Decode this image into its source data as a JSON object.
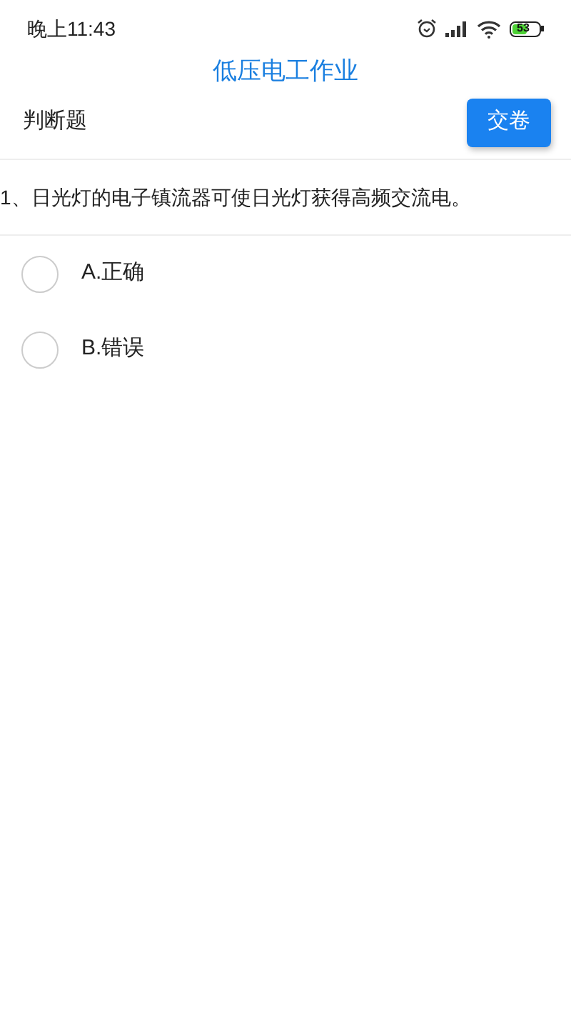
{
  "status_bar": {
    "time": "晚上11:43",
    "battery": "53"
  },
  "title": "低压电工作业",
  "header": {
    "section": "判断题",
    "submit_button": "交卷"
  },
  "question": "1、日光灯的电子镇流器可使日光灯获得高频交流电。",
  "options": [
    {
      "label": "A.正确",
      "selected": false
    },
    {
      "label": "B.错误",
      "selected": false
    }
  ]
}
